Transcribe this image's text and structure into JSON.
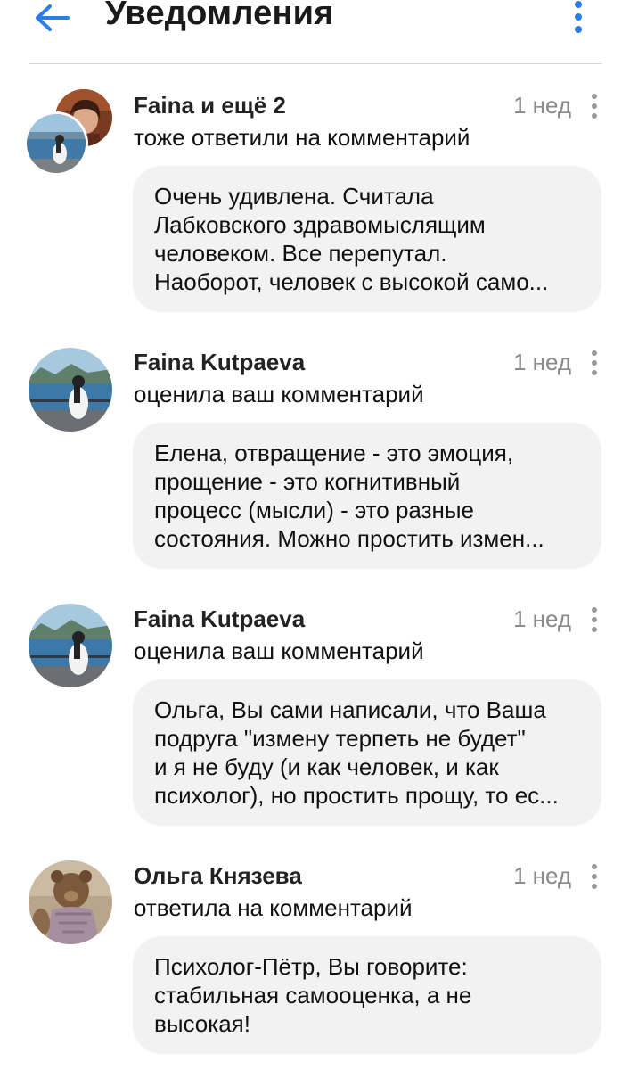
{
  "header": {
    "title": "Уведомления",
    "back_icon": "arrow-left-icon",
    "menu_icon": "more-vertical-icon",
    "accent_color": "#2b7de9"
  },
  "notifications": [
    {
      "actor": "Faina и ещё 2",
      "action": "тоже ответили на комментарий",
      "time": "1 нед",
      "avatar": "stacked-avatars",
      "comment_lines": [
        "Очень удивлена. Считала",
        "Лабковского здравомыслящим",
        "человеком. Все перепутал.",
        "Наоборот, человек с высокой само..."
      ]
    },
    {
      "actor": "Faina Kutpaeva",
      "action": "оценила ваш комментарий",
      "time": "1 нед",
      "avatar": "seaside-avatar",
      "comment_lines": [
        "Елена, отвращение - это эмоция,",
        "прощение - это когнитивный",
        "процесс (мысли) - это разные",
        "состояния. Можно простить измен..."
      ]
    },
    {
      "actor": "Faina Kutpaeva",
      "action": "оценила ваш комментарий",
      "time": "1 нед",
      "avatar": "seaside-avatar",
      "comment_lines": [
        "Ольга, Вы сами написали, что Ваша",
        "подруга \"измену терпеть не будет\"",
        "и я не буду (и как человек, и как",
        "психолог), но простить прощу, то ес..."
      ]
    },
    {
      "actor": "Ольга Князева",
      "action": "ответила на комментарий",
      "time": "1 нед",
      "avatar": "teddy-bear-avatar",
      "comment_lines": [
        "Психолог-Пётр, Вы говорите:",
        "стабильная самооценка, а не",
        "высокая!"
      ]
    }
  ]
}
